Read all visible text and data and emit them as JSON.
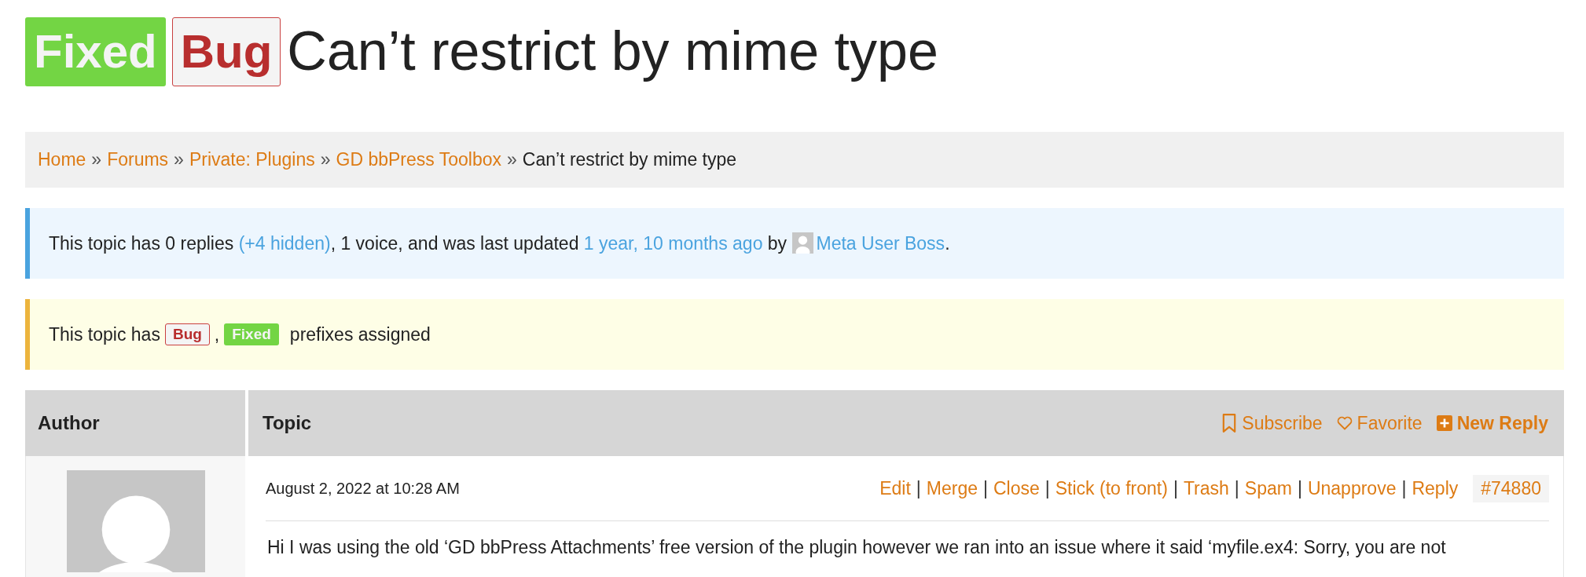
{
  "title": {
    "prefixes": [
      {
        "label": "Fixed",
        "kind": "fixed"
      },
      {
        "label": "Bug",
        "kind": "bug"
      }
    ],
    "text": "Can’t restrict by mime type"
  },
  "breadcrumb": [
    {
      "label": "Home",
      "kind": "link"
    },
    {
      "label": "»",
      "kind": "separator"
    },
    {
      "label": "Forums",
      "kind": "link"
    },
    {
      "label": "»",
      "kind": "separator"
    },
    {
      "label": "Private: Plugins",
      "kind": "link"
    },
    {
      "label": "»",
      "kind": "separator"
    },
    {
      "label": "GD bbPress Toolbox",
      "kind": "link"
    },
    {
      "label": "»",
      "kind": "separator"
    },
    {
      "label": "Can’t restrict by mime type",
      "kind": "current"
    }
  ],
  "info_notice": [
    {
      "text": "This topic has 0 replies ",
      "kind": "text"
    },
    {
      "text": "(+4 hidden)",
      "kind": "link"
    },
    {
      "text": ", 1 voice, and was last updated ",
      "kind": "text"
    },
    {
      "text": "1 year, 10 months ago",
      "kind": "link"
    },
    {
      "text": " by ",
      "kind": "text"
    },
    {
      "kind": "avatar"
    },
    {
      "text": "Meta User Boss",
      "kind": "link"
    },
    {
      "text": ".",
      "kind": "text"
    }
  ],
  "prefix_notice": {
    "before": "This topic has",
    "prefixes": [
      {
        "label": "Bug",
        "kind": "bug"
      },
      {
        "label": ",",
        "kind": "separator"
      },
      {
        "label": "Fixed",
        "kind": "fixed"
      }
    ],
    "after": "prefixes assigned"
  },
  "table": {
    "columns": [
      "Author",
      "Topic"
    ],
    "topic_actions": [
      {
        "label": "Subscribe",
        "kind": "subscribe"
      },
      {
        "label": "Favorite",
        "kind": "favorite"
      },
      {
        "label": "New Reply",
        "kind": "reply"
      }
    ],
    "post": {
      "date": "August 2, 2022 at 10:28 AM",
      "actions": [
        {
          "label": "Edit",
          "kind": "link"
        },
        {
          "label": "|",
          "kind": "separator"
        },
        {
          "label": "Merge",
          "kind": "link"
        },
        {
          "label": "|",
          "kind": "separator"
        },
        {
          "label": "Close",
          "kind": "link"
        },
        {
          "label": "|",
          "kind": "separator"
        },
        {
          "label": "Stick (to front)",
          "kind": "link"
        },
        {
          "label": "|",
          "kind": "separator"
        },
        {
          "label": "Trash",
          "kind": "link"
        },
        {
          "label": "|",
          "kind": "separator"
        },
        {
          "label": "Spam",
          "kind": "link"
        },
        {
          "label": "|",
          "kind": "separator"
        },
        {
          "label": "Unapprove",
          "kind": "link"
        },
        {
          "label": "|",
          "kind": "separator"
        },
        {
          "label": "Reply",
          "kind": "link"
        }
      ],
      "number": "#74880",
      "body": "Hi I was using the old ‘GD bbPress Attachments’ free version of the plugin however we ran into an issue where it said ‘myfile.ex4: Sorry, you are not"
    }
  }
}
